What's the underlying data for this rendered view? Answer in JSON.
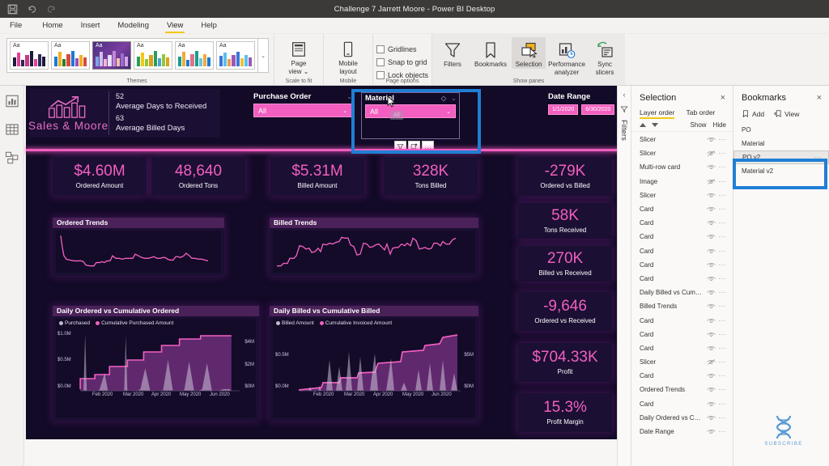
{
  "titlebar": {
    "title": "Challenge 7 Jarrett Moore - Power BI Desktop",
    "icons": [
      "save-icon",
      "undo-icon",
      "redo-icon"
    ]
  },
  "menubar": {
    "items": [
      {
        "label": "File",
        "active": false
      },
      {
        "label": "Home",
        "active": false
      },
      {
        "label": "Insert",
        "active": false
      },
      {
        "label": "Modeling",
        "active": false
      },
      {
        "label": "View",
        "active": true
      },
      {
        "label": "Help",
        "active": false
      }
    ]
  },
  "ribbon": {
    "groups": [
      {
        "label": "Themes"
      },
      {
        "label": "Scale to fit"
      },
      {
        "label": "Mobile"
      },
      {
        "label": "Page options"
      },
      {
        "label": "Show panes"
      }
    ],
    "themes": {
      "label": "Themes",
      "sample_text": "Aa",
      "selected_index": 2,
      "count": 6
    },
    "buttons": [
      {
        "name": "page-view-button",
        "label": "Page\nview",
        "caption_line1": "Page",
        "caption_line2": "view ⌄"
      },
      {
        "name": "mobile-layout-button",
        "caption_line1": "Mobile",
        "caption_line2": "layout"
      },
      {
        "name": "filters-pane-button",
        "caption_line1": "Filters",
        "caption_line2": ""
      },
      {
        "name": "bookmarks-pane-button",
        "caption_line1": "Bookmarks",
        "caption_line2": ""
      },
      {
        "name": "selection-pane-button",
        "caption_line1": "Selection",
        "caption_line2": ""
      },
      {
        "name": "performance-analyzer-button",
        "caption_line1": "Performance",
        "caption_line2": "analyzer"
      },
      {
        "name": "sync-slicers-button",
        "caption_line1": "Sync",
        "caption_line2": "slicers"
      }
    ],
    "checkboxes": [
      {
        "label": "Gridlines",
        "checked": false
      },
      {
        "label": "Snap to grid",
        "checked": false
      },
      {
        "label": "Lock objects",
        "checked": false
      }
    ]
  },
  "left_rail": {
    "items": [
      {
        "name": "report-view-icon",
        "active": true
      },
      {
        "name": "data-view-icon",
        "active": false
      },
      {
        "name": "model-view-icon",
        "active": false
      }
    ]
  },
  "report": {
    "brand": {
      "name": "Sales & Moore",
      "logo": "bar-chart-growth-icon",
      "metrics": [
        {
          "value": "52",
          "label": "Average Days to Received"
        },
        {
          "value": "63",
          "label": "Average Billed Days"
        }
      ]
    },
    "slicers": [
      {
        "name": "purchase-order-slicer",
        "title": "Purchase Order",
        "value": "All"
      },
      {
        "name": "material-slicer",
        "title": "Material",
        "value": "All"
      }
    ],
    "date_range": {
      "title": "Date Range",
      "start": "1/1/2020",
      "end": "6/30/2020"
    },
    "material_tooltip": "All",
    "floating_toolbar": [
      "filter-icon",
      "focus-mode-icon",
      "more-options-icon"
    ],
    "kpi_top": [
      {
        "value": "$4.60M",
        "label": "Ordered Amount"
      },
      {
        "value": "48,640",
        "label": "Ordered Tons"
      },
      {
        "value": "$5.31M",
        "label": "Billed Amount"
      },
      {
        "value": "328K",
        "label": "Tons Billed"
      },
      {
        "value": "-279K",
        "label": "Ordered vs Billed"
      }
    ],
    "kpi_right": [
      {
        "value": "58K",
        "label": "Tons Received"
      },
      {
        "value": "270K",
        "label": "Billed vs Received"
      },
      {
        "value": "-9,646",
        "label": "Ordered vs Received"
      },
      {
        "value": "$704.33K",
        "label": "Profit"
      },
      {
        "value": "15.3%",
        "label": "Profit Margin"
      }
    ],
    "charts": {
      "ordered_trends": {
        "title": "Ordered Trends"
      },
      "billed_trends": {
        "title": "Billed Trends"
      },
      "daily_ordered": {
        "title": "Daily Ordered vs Cumulative Ordered",
        "legend": [
          "Purchased",
          "Cumulative Purchased Amount"
        ],
        "y_left": [
          "$1.0M",
          "$0.5M",
          "$0.0M"
        ],
        "y_right": [
          "$4M",
          "$2M",
          "$0M"
        ],
        "x": [
          "Feb 2020",
          "Mar 2020",
          "Apr 2020",
          "May 2020",
          "Jun 2020"
        ]
      },
      "daily_billed": {
        "title": "Daily Billed vs Cumulative Billed",
        "legend": [
          "Billed Amount",
          "Cumulative Invoiced Amount"
        ],
        "y_left": [
          "$0.5M",
          "$0.0M"
        ],
        "y_right": [
          "$5M",
          "$0M"
        ],
        "x": [
          "Feb 2020",
          "Mar 2020",
          "Apr 2020",
          "May 2020",
          "Jun 2020"
        ]
      }
    },
    "subscribe": {
      "label": "SUBSCRIBE",
      "icon": "dna-helix-icon"
    }
  },
  "filters_rail": {
    "label": "Filters",
    "collapse_icon": "chevron-left-icon",
    "filter_icon": "filter-icon"
  },
  "selection_pane": {
    "title": "Selection",
    "close": "×",
    "tabs": [
      {
        "label": "Layer order",
        "active": true
      },
      {
        "label": "Tab order",
        "active": false
      }
    ],
    "show_label": "Show",
    "hide_label": "Hide",
    "items": [
      {
        "name": "Slicer",
        "hidden": false
      },
      {
        "name": "Slicer",
        "hidden": true
      },
      {
        "name": "Multi-row card",
        "hidden": false
      },
      {
        "name": "Image",
        "hidden": true
      },
      {
        "name": "Slicer",
        "hidden": false
      },
      {
        "name": "Card",
        "hidden": false
      },
      {
        "name": "Card",
        "hidden": false
      },
      {
        "name": "Card",
        "hidden": false
      },
      {
        "name": "Card",
        "hidden": false
      },
      {
        "name": "Card",
        "hidden": false
      },
      {
        "name": "Card",
        "hidden": false
      },
      {
        "name": "Daily Billed vs Cumul...",
        "hidden": false
      },
      {
        "name": "Billed Trends",
        "hidden": false
      },
      {
        "name": "Card",
        "hidden": false
      },
      {
        "name": "Card",
        "hidden": false
      },
      {
        "name": "Card",
        "hidden": false
      },
      {
        "name": "Slicer",
        "hidden": true
      },
      {
        "name": "Card",
        "hidden": false
      },
      {
        "name": "Ordered Trends",
        "hidden": false
      },
      {
        "name": "Card",
        "hidden": false
      },
      {
        "name": "Daily Ordered vs Cu...",
        "hidden": false
      },
      {
        "name": "Date Range",
        "hidden": false
      }
    ]
  },
  "bookmarks_pane": {
    "title": "Bookmarks",
    "close": "×",
    "actions": [
      {
        "label": "Add",
        "icon": "add-bookmark-icon"
      },
      {
        "label": "View",
        "icon": "view-bookmark-icon"
      }
    ],
    "items": [
      {
        "label": "PO",
        "selected": false
      },
      {
        "label": "Material",
        "selected": false
      },
      {
        "label": "PO v2",
        "selected": true
      },
      {
        "label": "Material v2",
        "selected": false
      }
    ]
  },
  "colors": {
    "accent_pink": "#f25fc0",
    "report_bg": "#120a26",
    "card_bg": "#1b0f33",
    "panel_header": "#4a2158",
    "annotation_blue": "#1f7fd4",
    "ribbon_yellow": "#f2c811"
  }
}
